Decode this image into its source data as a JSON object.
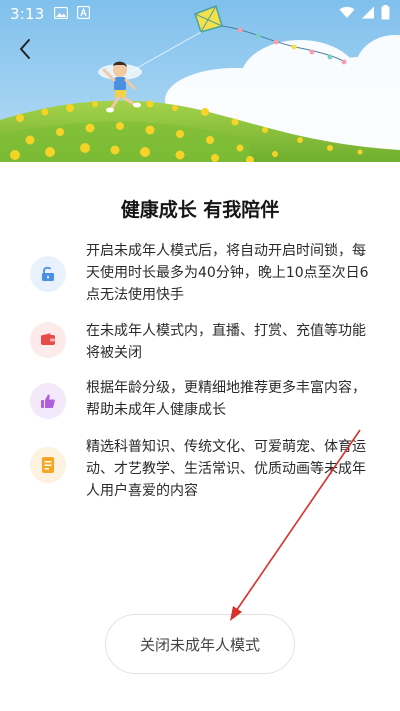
{
  "status_bar": {
    "time": "3:13",
    "icons_left": [
      "image-icon",
      "a-icon"
    ],
    "icons_right": [
      "wifi-icon",
      "signal-icon",
      "battery-icon"
    ]
  },
  "header": {
    "back_icon": "chevron-left-icon"
  },
  "hero": {
    "description_icons": [
      "kite-icon",
      "child-icon",
      "flowers-icon"
    ],
    "colors": {
      "sky": "#8ec8ef",
      "hill": "#8cc63f",
      "flowers": "#f5d327"
    }
  },
  "main": {
    "title": "健康成长 有我陪伴",
    "features": [
      {
        "icon": "lock-icon",
        "icon_color": "#4a90e2",
        "icon_bg": "#e9f2fc",
        "text": "开启未成年人模式后，将自动开启时间锁，每天使用时长最多为40分钟，晚上10点至次日6点无法使用快手"
      },
      {
        "icon": "wallet-icon",
        "icon_color": "#e84a4a",
        "icon_bg": "#fdeaea",
        "text": "在未成年人模式内，直播、打赏、充值等功能将被关闭"
      },
      {
        "icon": "thumbs-up-icon",
        "icon_color": "#b05ee0",
        "icon_bg": "#f4e9fb",
        "text": "根据年龄分级，更精细地推荐更多丰富内容，帮助未成年人健康成长"
      },
      {
        "icon": "document-icon",
        "icon_color": "#f5a623",
        "icon_bg": "#fdf2e0",
        "text": "精选科普知识、传统文化、可爱萌宠、体育运动、才艺教学、生活常识、优质动画等未成年人用户喜爱的内容"
      }
    ],
    "close_button_label": "关闭未成年人模式"
  },
  "annotation": {
    "color": "#d9302c"
  }
}
